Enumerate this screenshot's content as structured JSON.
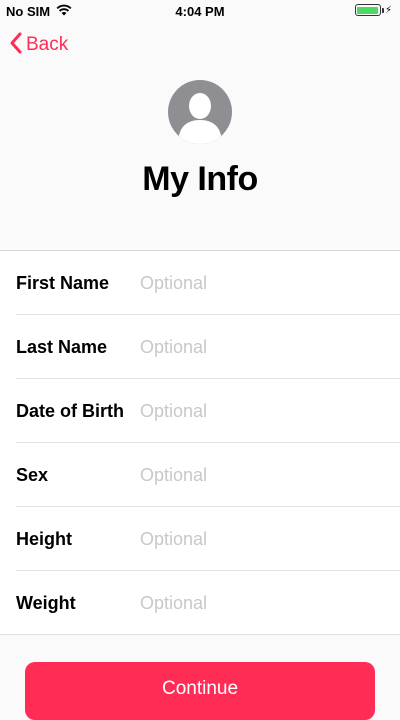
{
  "status_bar": {
    "carrier": "No SIM",
    "time": "4:04 PM"
  },
  "nav": {
    "back_label": "Back"
  },
  "header": {
    "title": "My Info"
  },
  "form": {
    "fields": [
      {
        "label": "First Name",
        "placeholder": "Optional",
        "value": ""
      },
      {
        "label": "Last Name",
        "placeholder": "Optional",
        "value": ""
      },
      {
        "label": "Date of Birth",
        "placeholder": "Optional",
        "value": ""
      },
      {
        "label": "Sex",
        "placeholder": "Optional",
        "value": ""
      },
      {
        "label": "Height",
        "placeholder": "Optional",
        "value": ""
      },
      {
        "label": "Weight",
        "placeholder": "Optional",
        "value": ""
      }
    ]
  },
  "continue_label": "Continue",
  "colors": {
    "accent": "#ff2d55",
    "placeholder": "#c7c7cc",
    "avatar": "#8e8e93",
    "battery": "#4cd964"
  },
  "icons": {
    "wifi": "wifi-icon",
    "battery": "battery-icon",
    "charging": "charging-bolt-icon",
    "back": "chevron-left-icon",
    "avatar": "person-silhouette-icon"
  }
}
